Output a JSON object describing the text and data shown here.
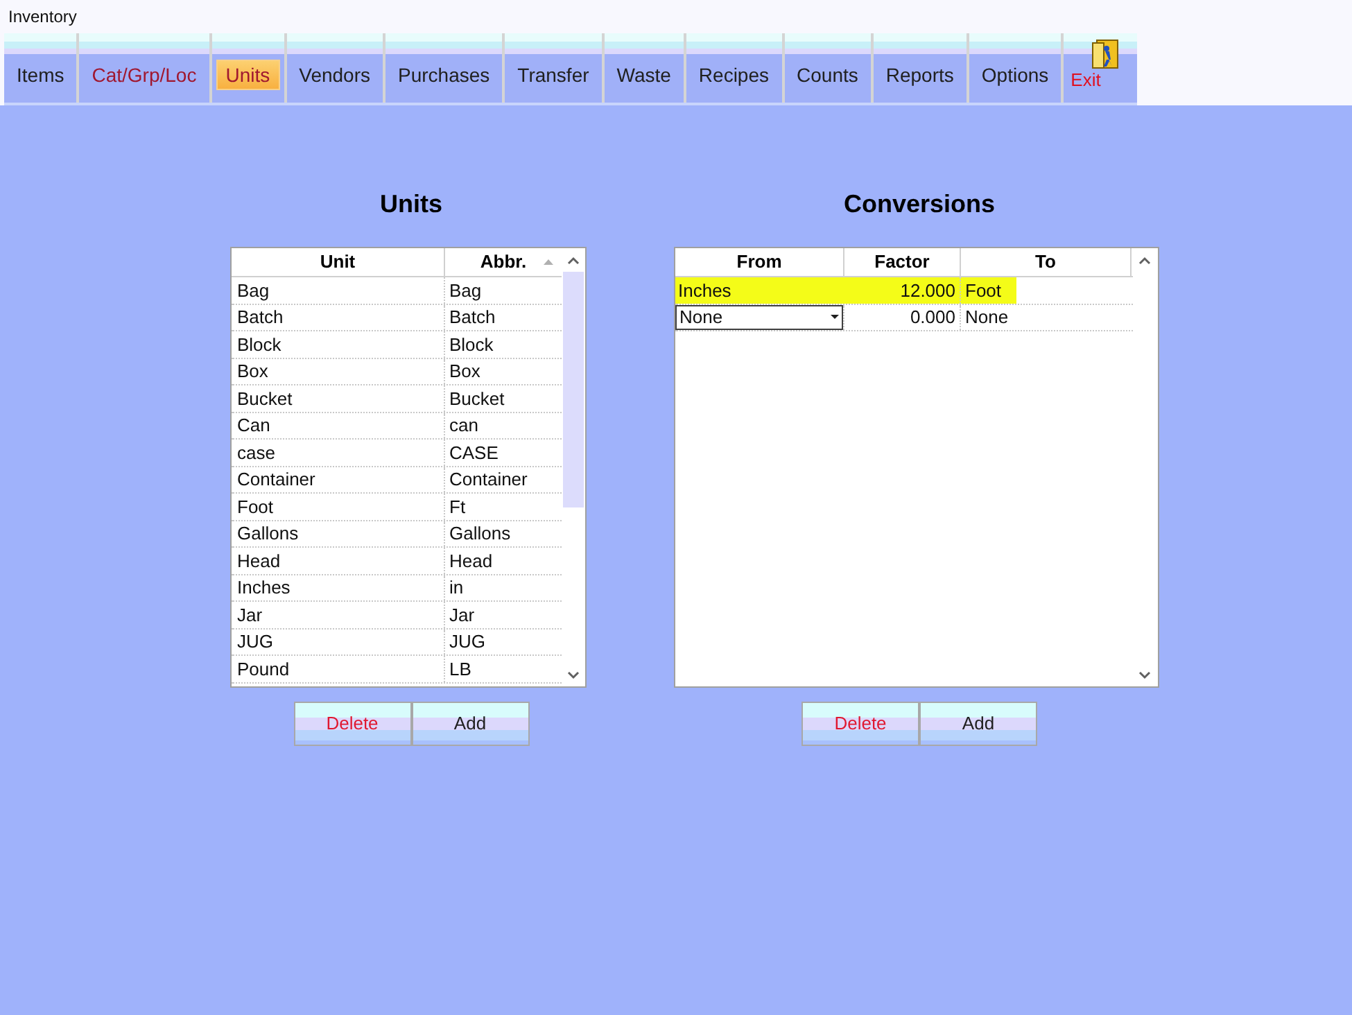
{
  "window": {
    "title": "Inventory"
  },
  "tabs": [
    {
      "label": "Items",
      "selected": false,
      "color": "#202020"
    },
    {
      "label": "Cat/Grp/Loc",
      "selected": false,
      "color": "#a01830"
    },
    {
      "label": "Units",
      "selected": true,
      "color": "#a01830"
    },
    {
      "label": "Vendors",
      "selected": false,
      "color": "#202020"
    },
    {
      "label": "Purchases",
      "selected": false,
      "color": "#202020"
    },
    {
      "label": "Transfer",
      "selected": false,
      "color": "#202020"
    },
    {
      "label": "Waste",
      "selected": false,
      "color": "#202020"
    },
    {
      "label": "Recipes",
      "selected": false,
      "color": "#202020"
    },
    {
      "label": "Counts",
      "selected": false,
      "color": "#202020"
    },
    {
      "label": "Reports",
      "selected": false,
      "color": "#202020"
    },
    {
      "label": "Options",
      "selected": false,
      "color": "#202020"
    }
  ],
  "exit": {
    "label": "Exit"
  },
  "units": {
    "title": "Units",
    "columns": [
      {
        "label": "Unit",
        "sorted": false
      },
      {
        "label": "Abbr.",
        "sorted": true
      }
    ],
    "rows": [
      [
        "Bag",
        "Bag"
      ],
      [
        "Batch",
        "Batch"
      ],
      [
        "Block",
        "Block"
      ],
      [
        "Box",
        "Box"
      ],
      [
        "Bucket",
        "Bucket"
      ],
      [
        "Can",
        "can"
      ],
      [
        "case",
        "CASE"
      ],
      [
        "Container",
        "Container"
      ],
      [
        "Foot",
        "Ft"
      ],
      [
        "Gallons",
        "Gallons"
      ],
      [
        "Head",
        "Head"
      ],
      [
        "Inches",
        "in"
      ],
      [
        "Jar",
        "Jar"
      ],
      [
        "JUG",
        "JUG"
      ],
      [
        "Pound",
        "LB"
      ]
    ],
    "buttons": [
      "Delete",
      "Add"
    ]
  },
  "conversions": {
    "title": "Conversions",
    "columns": [
      {
        "label": "From"
      },
      {
        "label": "Factor"
      },
      {
        "label": "To"
      }
    ],
    "rows": [
      {
        "from": "Inches",
        "factor": "12.000",
        "to": "Foot",
        "highlighted": true,
        "kind": "text"
      },
      {
        "from": "None",
        "factor": "0.000",
        "to": "None",
        "highlighted": false,
        "kind": "dropdown"
      }
    ],
    "buttons": [
      "Delete",
      "Add"
    ]
  }
}
